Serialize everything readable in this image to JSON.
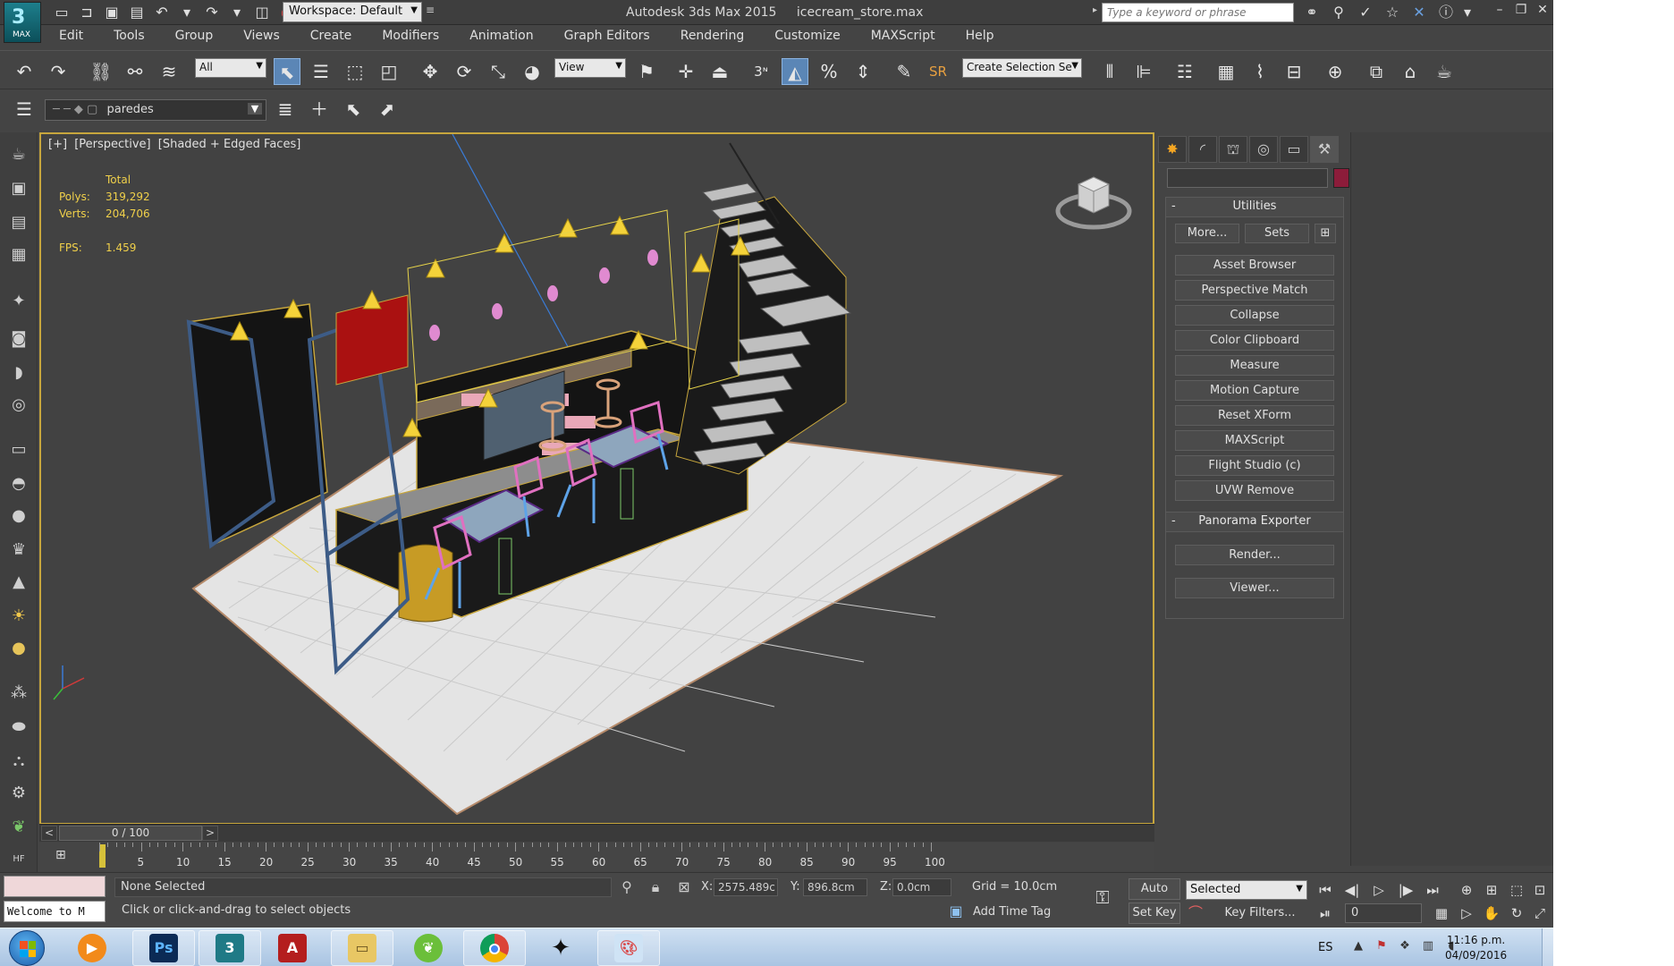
{
  "titlebar": {
    "app_logo_label": "MAX",
    "workspace": "Workspace: Default",
    "app_name": "Autodesk 3ds Max  2015",
    "file_name": "icecream_store.max",
    "search_placeholder": "Type a keyword or phrase"
  },
  "menu": [
    "Edit",
    "Tools",
    "Group",
    "Views",
    "Create",
    "Modifiers",
    "Animation",
    "Graph Editors",
    "Rendering",
    "Customize",
    "MAXScript",
    "Help"
  ],
  "toolbar": {
    "selection_filter": "All",
    "ref_coord": "View",
    "named_selection": "Create Selection Se",
    "snap_label": "3",
    "sr_label": "SR"
  },
  "layer": {
    "name": "paredes"
  },
  "viewport": {
    "plus": "[+]",
    "view": "[Perspective]",
    "shading": "[Shaded + Edged Faces]",
    "stats": {
      "total_label": "Total",
      "polys_label": "Polys:",
      "polys": "319,292",
      "verts_label": "Verts:",
      "verts": "204,706",
      "fps_label": "FPS:",
      "fps": "1.459"
    }
  },
  "command_panel": {
    "utilities_title": "Utilities",
    "more": "More...",
    "sets": "Sets",
    "buttons": [
      "Asset Browser",
      "Perspective Match",
      "Collapse",
      "Color Clipboard",
      "Measure",
      "Motion Capture",
      "Reset XForm",
      "MAXScript",
      "Flight Studio (c)",
      "UVW Remove"
    ],
    "panorama_title": "Panorama Exporter",
    "render": "Render...",
    "viewer": "Viewer..."
  },
  "timeline": {
    "slider": "0 / 100",
    "ticks": [
      "5",
      "10",
      "15",
      "20",
      "25",
      "30",
      "35",
      "40",
      "45",
      "50",
      "55",
      "60",
      "65",
      "70",
      "75",
      "80",
      "85",
      "90",
      "95",
      "100"
    ]
  },
  "status": {
    "listener": "Welcome to M",
    "selection": "None Selected",
    "prompt": "Click or click-and-drag to select objects",
    "x_label": "X:",
    "x": "2575.489c",
    "y_label": "Y:",
    "y": "896.8cm",
    "z_label": "Z:",
    "z": "0.0cm",
    "grid": "Grid = 10.0cm",
    "add_time_tag": "Add Time Tag",
    "auto_key": "Auto Key",
    "set_key": "Set Key",
    "key_mode": "Selected",
    "key_filters": "Key Filters...",
    "frame": "0"
  },
  "taskbar": {
    "lang": "ES",
    "time": "11:16 p.m.",
    "date": "04/09/2016"
  },
  "colors": {
    "viewport_border": "#c7a63d",
    "stats_text": "#f0d04a",
    "object_color_swatch": "#8c1c3a"
  }
}
